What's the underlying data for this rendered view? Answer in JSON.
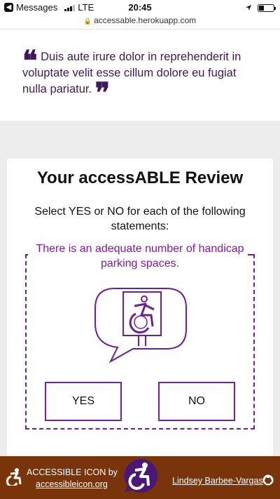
{
  "status_bar": {
    "back_label": "Messages",
    "carrier": "LTE",
    "time": "20:45",
    "battery_level": 0.35
  },
  "browser": {
    "url": "accessable.herokuapp.com"
  },
  "quote": {
    "open_mark": "❝",
    "text": "Duis aute irure dolor in reprehenderit in voluptate velit esse cillum dolore eu fugiat nulla pariatur.",
    "close_mark": "❞"
  },
  "review": {
    "title": "Your accessABLE Review",
    "instructions": "Select YES or NO for each of the following statements:",
    "question": "There is an adequate number of handicap parking spaces.",
    "illustration_icon": "accessible-parking-sign-icon",
    "yes_label": "YES",
    "no_label": "NO"
  },
  "footer": {
    "line1": "ACCESSIBLE ICON by",
    "link": "accessibleicon.org",
    "author": "Lindsey Barbee-Vargas",
    "icons": [
      "accessible-icon",
      "accessible-badge-icon",
      "github-icon"
    ]
  },
  "colors": {
    "brand_purple": "#6a1fa0",
    "question_purple": "#8b14a8",
    "quote_purple": "#3d1a5b",
    "footer_brown": "#7a3409"
  }
}
